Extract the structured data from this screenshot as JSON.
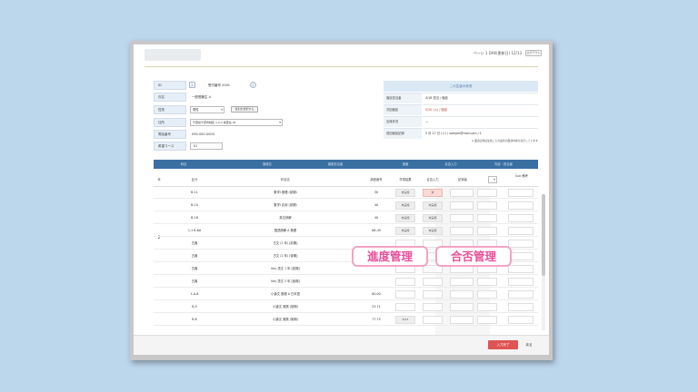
{
  "header": {
    "title": "ページ 1 DAK(更新日) 12/13",
    "button": "ログアウト"
  },
  "form": {
    "fields": [
      {
        "label": "ID",
        "value": "受付番号 0001"
      },
      {
        "label": "氏名",
        "value": "一般受験生 A"
      },
      {
        "label": "性別",
        "value": "男性",
        "button": "性別を選択する"
      },
      {
        "label": "住所",
        "value": "千葉県千葉市緑区 1-2-3 青葉台 4F"
      },
      {
        "label": "電話番号",
        "value": "090-000-0000"
      },
      {
        "label": "希望コース",
        "value": "01"
      }
    ]
  },
  "status_panel": {
    "title": "この生徒の状況",
    "rows": [
      {
        "label": "面談担当者",
        "value": "4/18 担当 / 面談"
      },
      {
        "label": "次回面談",
        "value": "5/20 (火) / 面談",
        "red": true
      },
      {
        "label": "出席状況",
        "value": "—"
      },
      {
        "label": "前回面談記録",
        "value": "5 月 17 日 (ジ) / sample@mail.com / 1"
      }
    ],
    "note": "※ 面談記録は生徒ごとの最新の面談内容を表示しています"
  },
  "table": {
    "columns": [
      "科目",
      "講座名",
      "講座担当者",
      "進度",
      "合否入力",
      "内容・担当者"
    ],
    "subheader": [
      "年",
      "区分",
      "科目名",
      "講座番号",
      "学習結果",
      "合否入力",
      "記録者",
      "",
      "",
      "Sub 備考"
    ],
    "rows": [
      {
        "code": "B-11",
        "name": "数学Ⅰ 基礎 (前期)",
        "num": "30",
        "a": "未実施",
        "b": "未",
        "b_pink": true
      },
      {
        "code": "B-10",
        "name": "数学Ⅰ 応用 (前期)",
        "num": "40",
        "a": "未実施",
        "b": "未実施"
      },
      {
        "code": "B-16",
        "name": "英文読解",
        "num": "40",
        "a": "未実施",
        "b": "未実施"
      },
      {
        "code": "1-1 B-6A",
        "name": "国語読解 A 基礎",
        "num": "AB-45",
        "a": "未実施",
        "b": "未実施"
      },
      {
        "code": "古典",
        "name": "古文 (1 年) [前期]",
        "num": "",
        "a": "",
        "b": ""
      },
      {
        "code": "古典",
        "name": "古文 (2 年) [後期]",
        "num": "",
        "a": "",
        "b": ""
      },
      {
        "code": "古典",
        "name": "Key 漢文 1 年 [前期]",
        "num": "",
        "a": "",
        "b": ""
      },
      {
        "code": "古典",
        "name": "Key 漢文 2 年 [後期]",
        "num": "",
        "a": "",
        "b": ""
      },
      {
        "code": "1-A-6",
        "name": "小論文 基礎 A 日本語",
        "num": "60.00",
        "a": "",
        "b": ""
      },
      {
        "code": "B-9",
        "name": "小論文 実践 (前期)",
        "num": "23.71",
        "a": "",
        "b": ""
      },
      {
        "code": "B-8",
        "name": "小論文 実践 (後期)",
        "num": "77.75",
        "a": "8/15",
        "b": ""
      }
    ],
    "row_group": "2"
  },
  "overlays": {
    "progress": "進度管理",
    "result": "合否管理"
  },
  "footer": {
    "save": "入力完了",
    "cancel": "戻る"
  }
}
